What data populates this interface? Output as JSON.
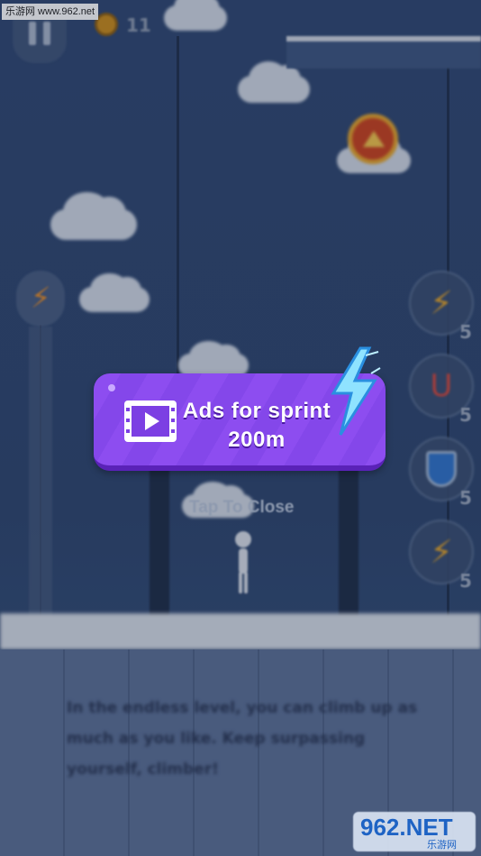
{
  "watermark_top": "乐游网 www.962.net",
  "hud": {
    "coin_count": "11"
  },
  "ad_offer": {
    "line1": "Ads for sprint",
    "line2": "200m"
  },
  "tap_to_close": "Tap To Close",
  "powerups": [
    {
      "name": "winged-bolt",
      "count": "5"
    },
    {
      "name": "magnet",
      "count": "5"
    },
    {
      "name": "shield",
      "count": "5"
    },
    {
      "name": "bolt-plus",
      "count": "5"
    }
  ],
  "tip": "In the endless level, you can climb up as much as you like.  Keep surpassing yourself, climber!",
  "watermark_bottom": {
    "brand": "962.NET",
    "sub": "乐游网"
  },
  "colors": {
    "ad_purple": "#8d4df0",
    "bolt_blue": "#4fc3ff",
    "bolt_orange": "#e08a2a"
  },
  "icons": [
    "pause-icon",
    "coin-icon",
    "video-icon",
    "lightning-icon",
    "magnet-icon",
    "shield-icon"
  ]
}
